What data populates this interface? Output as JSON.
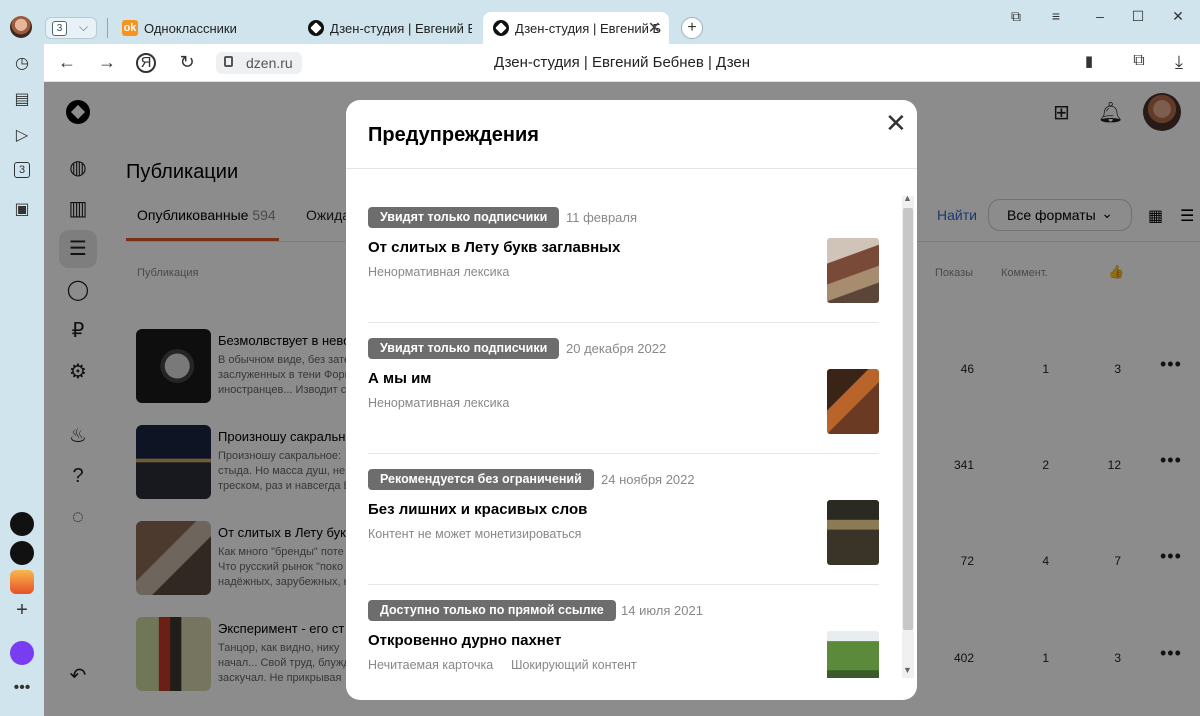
{
  "browser": {
    "tab_count": "3",
    "tabs": [
      {
        "title": "Одноклассники",
        "favicon": "ok-icon"
      },
      {
        "title": "Дзен-студия | Евгений Бебнев",
        "favicon": "dzen-icon"
      },
      {
        "title": "Дзен-студия | Евгений Б",
        "favicon": "dzen-icon",
        "active": true
      }
    ],
    "address": {
      "host": "dzen.ru",
      "page_title": "Дзен-студия | Евгений Бебнев | Дзен"
    }
  },
  "studio": {
    "page_title": "Публикации",
    "tabs": {
      "published_label": "Опубликованные",
      "published_count": "594",
      "waiting_label": "Ожида"
    },
    "find_label": "Найти",
    "formats_label": "Все форматы",
    "columns": {
      "publication": "Публикация",
      "views": "Показы",
      "comments": "Коммент."
    },
    "rows": [
      {
        "title": "Безмолвствует в невол",
        "snippet": [
          "В обычном виде, без зате",
          "заслуженных в тени Форм",
          "иностранцев... Изводит с"
        ],
        "views": "46",
        "comments": "1",
        "likes": "3"
      },
      {
        "title": "Произношу сакральное",
        "snippet": [
          "Произношу сакральное:",
          "стыда. Но масса душ, не и",
          "треском, раз и навсегда Е"
        ],
        "views": "341",
        "comments": "2",
        "likes": "12"
      },
      {
        "title": "От слитых в Лету букв",
        "snippet": [
          "Как много \"бренды\" поте",
          "Что русский рынок \"поко",
          "надёжных, зарубежных, н"
        ],
        "views": "72",
        "comments": "4",
        "likes": "7"
      },
      {
        "title": "Эксперимент - его ст",
        "snippet": [
          "Танцор, как видно, нику",
          "начал... Свой труд, блужд",
          "заскучал. Не прикрывая"
        ],
        "views": "402",
        "comments": "1",
        "likes": "3"
      }
    ]
  },
  "modal": {
    "title": "Предупреждения",
    "items": [
      {
        "badge": "Увидят только подписчики",
        "date": "11 февраля",
        "title": "От слитых в Лету букв заглавных",
        "reasons": [
          "Ненормативная лексика"
        ]
      },
      {
        "badge": "Увидят только подписчики",
        "date": "20 декабря 2022",
        "title": "А мы им",
        "reasons": [
          "Ненормативная лексика"
        ]
      },
      {
        "badge": "Рекомендуется без ограничений",
        "date": "24 ноября 2022",
        "title": "Без лишних и красивых слов",
        "reasons": [
          "Контент не может монетизироваться"
        ]
      },
      {
        "badge": "Доступно только по прямой ссылке",
        "date": "14 июля 2021",
        "title": "Откровенно дурно пахнет",
        "reasons": [
          "Нечитаемая карточка",
          "Шокирующий контент"
        ]
      }
    ]
  },
  "colors": {
    "accent_underline": "#e05a2b",
    "link": "#3366cc",
    "badge_bg": "#6d6d6d",
    "overlay": "rgba(0,0,0,0.45)"
  }
}
